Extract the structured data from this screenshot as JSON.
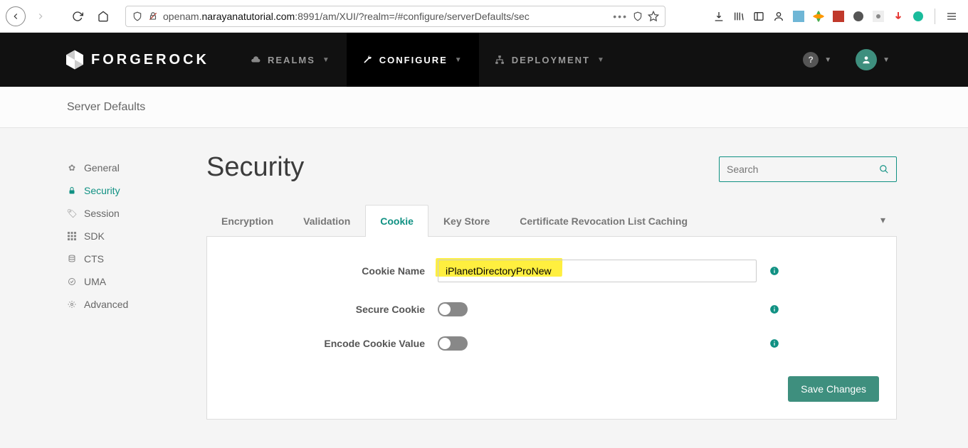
{
  "browser": {
    "url_prefix": "openam.",
    "url_host": "narayanatutorial.com",
    "url_suffix": ":8991/am/XUI/?realm=/#configure/serverDefaults/sec"
  },
  "topnav": {
    "brand": "FORGEROCK",
    "items": [
      {
        "label": "REALMS",
        "icon": "cloud"
      },
      {
        "label": "CONFIGURE",
        "icon": "wrench",
        "active": true
      },
      {
        "label": "DEPLOYMENT",
        "icon": "sitemap"
      }
    ]
  },
  "breadcrumb": "Server Defaults",
  "sidebar": {
    "items": [
      {
        "label": "General",
        "icon": "gear"
      },
      {
        "label": "Security",
        "icon": "lock",
        "active": true
      },
      {
        "label": "Session",
        "icon": "ticket"
      },
      {
        "label": "SDK",
        "icon": "grid"
      },
      {
        "label": "CTS",
        "icon": "database"
      },
      {
        "label": "UMA",
        "icon": "check-circle"
      },
      {
        "label": "Advanced",
        "icon": "sliders"
      }
    ]
  },
  "page": {
    "title": "Security",
    "search_placeholder": "Search"
  },
  "tabs": [
    {
      "label": "Encryption"
    },
    {
      "label": "Validation"
    },
    {
      "label": "Cookie",
      "active": true
    },
    {
      "label": "Key Store"
    },
    {
      "label": "Certificate Revocation List Caching"
    }
  ],
  "form": {
    "cookie_name_label": "Cookie Name",
    "cookie_name_value": "iPlanetDirectoryProNew",
    "secure_cookie_label": "Secure Cookie",
    "secure_cookie_value": false,
    "encode_cookie_label": "Encode Cookie Value",
    "encode_cookie_value": false,
    "save_label": "Save Changes"
  }
}
